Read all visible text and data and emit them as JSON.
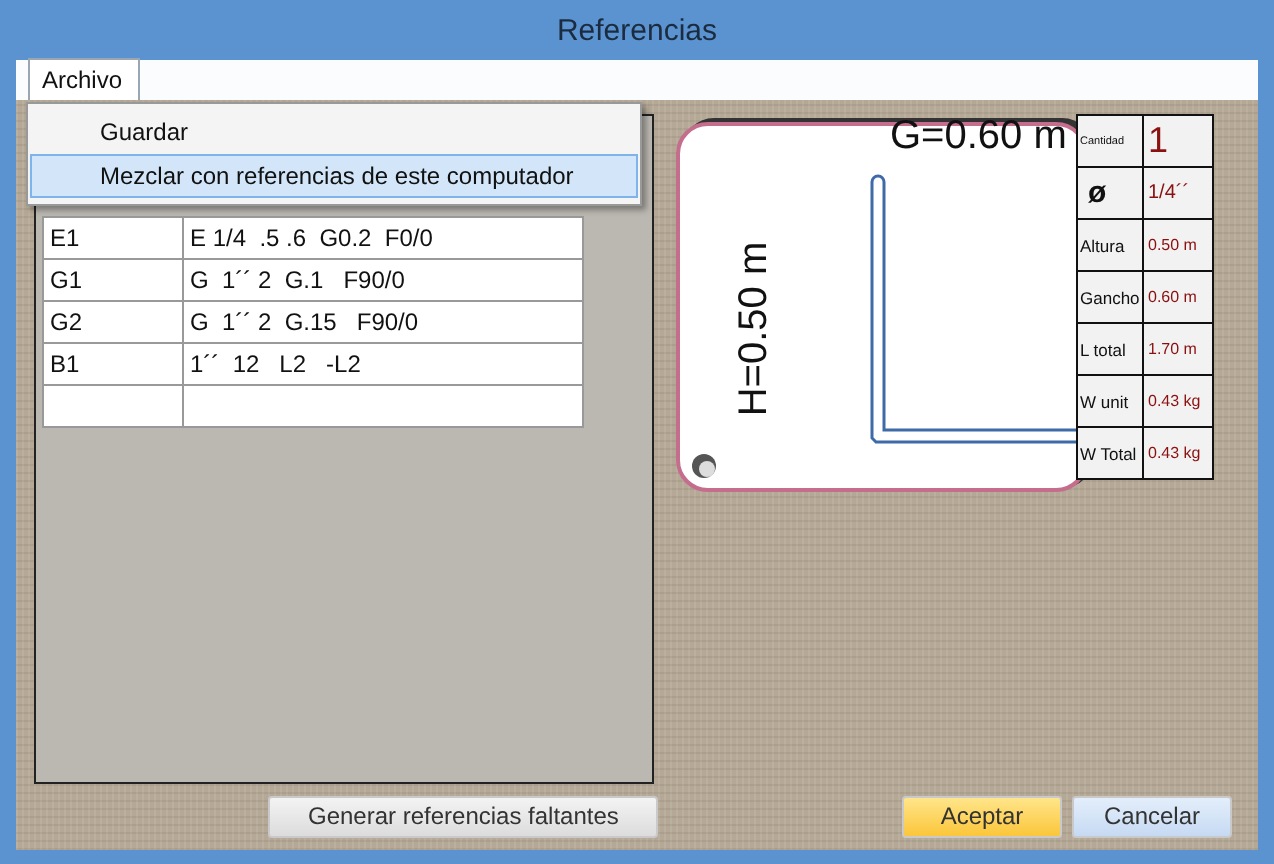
{
  "window": {
    "title": "Referencias"
  },
  "menu": {
    "label": "Archivo",
    "open": true,
    "items": [
      {
        "label": "Guardar",
        "selected": false
      },
      {
        "label": "Mezclar con referencias de este computador",
        "selected": true
      }
    ]
  },
  "references": {
    "rows": [
      {
        "code": "E1",
        "spec": "E 1/4  .5 .6  G0.2  F0/0"
      },
      {
        "code": "G1",
        "spec": "G  1´´ 2  G.1   F90/0"
      },
      {
        "code": "G2",
        "spec": "G  1´´ 2  G.15   F90/0"
      },
      {
        "code": "B1",
        "spec": "1´´  12   L2   -L2"
      }
    ]
  },
  "drawing": {
    "top_label": "G=0.60 m",
    "side_label": "H=0.50 m"
  },
  "properties": [
    {
      "kind": "count",
      "label": "Cantidad",
      "value": "1"
    },
    {
      "kind": "symbol",
      "label": "ø",
      "value": "1/4´´"
    },
    {
      "kind": "measure",
      "label": "Altura",
      "value": "0.50 m"
    },
    {
      "kind": "measure",
      "label": "Gancho",
      "value": "0.60 m"
    },
    {
      "kind": "measure",
      "label": "L total",
      "value": "1.70 m"
    },
    {
      "kind": "measure",
      "label": "W unit",
      "value": "0.43 kg"
    },
    {
      "kind": "measure",
      "label": "W Total",
      "value": "0.43 kg"
    }
  ],
  "buttons": [
    {
      "label": "Generar referencias faltantes",
      "kind": "secondary"
    },
    {
      "label": "Aceptar",
      "kind": "primary"
    },
    {
      "label": "Cancelar",
      "kind": "cancel"
    }
  ]
}
